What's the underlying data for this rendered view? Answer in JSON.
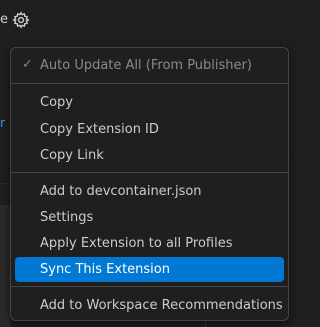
{
  "background": {
    "top_text": "e",
    "left_link_text": "r"
  },
  "menu": {
    "items": [
      {
        "label": "Auto Update All (From Publisher)",
        "checked": true,
        "disabled": true
      },
      {
        "label": "Copy"
      },
      {
        "label": "Copy Extension ID"
      },
      {
        "label": "Copy Link"
      },
      {
        "label": "Add to devcontainer.json"
      },
      {
        "label": "Settings"
      },
      {
        "label": "Apply Extension to all Profiles"
      },
      {
        "label": "Sync This Extension",
        "highlighted": true
      },
      {
        "label": "Add to Workspace Recommendations"
      }
    ],
    "check_glyph": "✓"
  },
  "colors": {
    "menu_bg": "#1f1f1f",
    "highlight": "#0078d4",
    "link": "#3794ff",
    "separator": "#454545"
  }
}
